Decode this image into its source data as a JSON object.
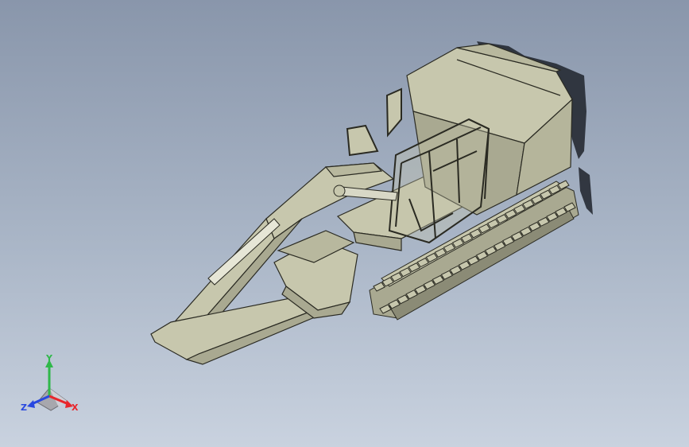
{
  "viewport": {
    "background_top": "#8996ab",
    "background_bottom": "#c9d2df",
    "model_color": "#c7c7ad",
    "model_shade": "#a9a991",
    "model_dark": "#8b8b76",
    "edge_color": "#2a2a22",
    "shadow_color": "#1f232b"
  },
  "triad": {
    "x_label": "X",
    "y_label": "Y",
    "z_label": "Z",
    "x_color": "#e8262c",
    "y_color": "#2fb84a",
    "z_color": "#2848e0"
  }
}
